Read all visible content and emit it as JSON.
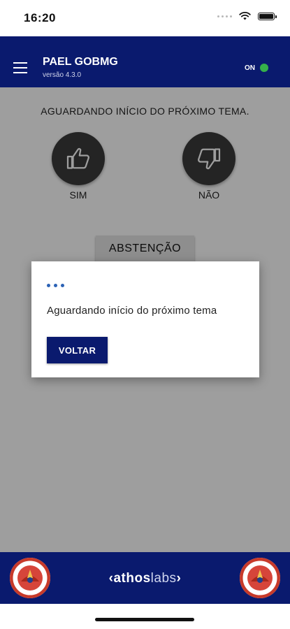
{
  "status_bar": {
    "time": "16:20"
  },
  "header": {
    "title": "PAEL GOBMG",
    "version": "versão 4.3.0",
    "connection_label": "ON",
    "connection_color": "#35b04a",
    "menu_icon": "hamburger-menu-icon"
  },
  "main": {
    "topic_status": "AGUARDANDO INÍCIO DO PRÓXIMO TEMA.",
    "vote_yes": {
      "label": "SIM",
      "icon": "thumbs-up-icon"
    },
    "vote_no": {
      "label": "NÃO",
      "icon": "thumbs-down-icon"
    },
    "abstention_label": "ABSTENÇÃO"
  },
  "dialog": {
    "message": "Aguardando início do próximo tema",
    "back_label": "VOLTAR",
    "loading_icon": "loading-dots-icon"
  },
  "footer": {
    "brand_bold": "athos",
    "brand_light": "labs",
    "brand_prefix": "‹",
    "brand_suffix": "›"
  },
  "colors": {
    "primary": "#0a1a6e",
    "accent_dots": "#2c62b5",
    "vote_button": "#3a3a3a"
  }
}
